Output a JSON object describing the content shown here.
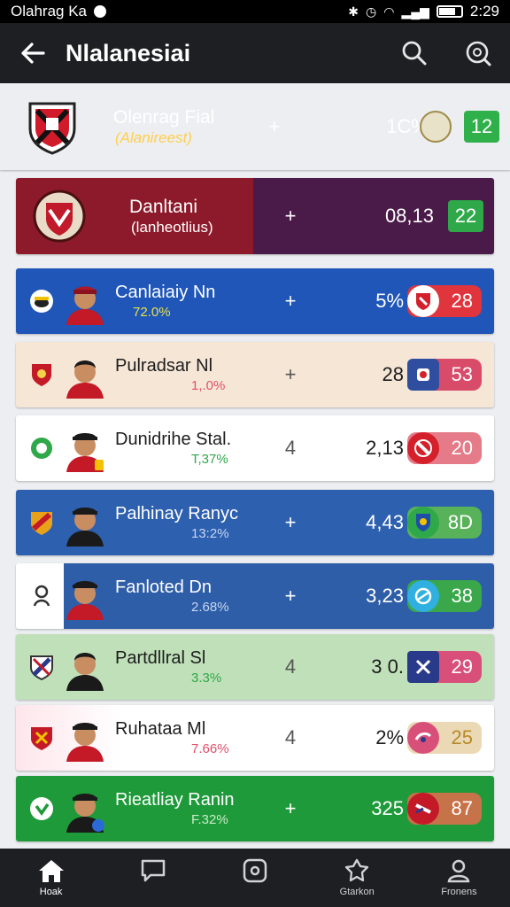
{
  "status_bar": {
    "left_text": "Olahrag Ka",
    "time": "2:29"
  },
  "app_bar": {
    "title": "Nlalanesiai",
    "icons": [
      "back-arrow-icon",
      "search-icon",
      "search-badge-icon"
    ]
  },
  "rows": [
    {
      "name": "Olenrag Fial",
      "sub": "(Alanireest)",
      "plus": "+",
      "stat": "1C%",
      "badge": "12",
      "bg": "#c4182c",
      "badge_bg": "#2fb04a"
    },
    {
      "name": "Danltani",
      "sub": "(lanheotlius)",
      "plus": "+",
      "stat": "08,13",
      "badge": "22",
      "bg": "#8d1a2a",
      "bg2": "#4a1a48",
      "badge_bg": "#2fa84a"
    },
    {
      "name": "Canlaiaiy Nn",
      "sub": "72.0%",
      "plus": "+",
      "stat": "5%",
      "badge": "28",
      "bg": "#1f56b8",
      "badge_bg": "#e0353d"
    },
    {
      "name": "Pulradsar Nl",
      "sub": "1,.0%",
      "plus": "+",
      "stat": "28",
      "badge": "53",
      "bg": "#f6e6d6",
      "badge_bg": "#d84c6a"
    },
    {
      "name": "Dunidrihe Stal.",
      "sub": "T,37%",
      "plus": "4",
      "stat": "2,13",
      "badge": "20",
      "bg": "#ffffff",
      "badge_bg": "#e57a88"
    },
    {
      "name": "Palhinay Ranyc",
      "sub": "13:2%",
      "plus": "+",
      "stat": "4,43",
      "badge": "8D",
      "bg": "#2e60b0",
      "badge_bg": "#58b25a"
    },
    {
      "name": "Fanloted Dn",
      "sub": "2.68%",
      "plus": "+",
      "stat": "3,23",
      "badge": "38",
      "bg": "#2e5ea8",
      "badge_bg": "#3aa84a"
    },
    {
      "name": "Partdllral Sl",
      "sub": "3.3%",
      "plus": "4",
      "stat": "3 0.",
      "badge": "29",
      "bg": "#bfe0b8",
      "badge_bg": "#d8507a"
    },
    {
      "name": "Ruhataa Ml",
      "sub": "7.66%",
      "plus": "4",
      "stat": "2%",
      "badge": "25",
      "bg": "#ffffff",
      "badge_bg": "#ead9b4"
    },
    {
      "name": "Rieatliay Ranin",
      "sub": "F.32%",
      "plus": "+",
      "stat": "325",
      "badge": "87",
      "bg": "#1f9a3a",
      "badge_bg": "#c7734a"
    }
  ],
  "nav": [
    {
      "label": "Hoak",
      "icon": "home-icon"
    },
    {
      "label": "",
      "icon": "chat-icon"
    },
    {
      "label": "",
      "icon": "media-icon"
    },
    {
      "label": "Gtarkon",
      "icon": "badge-icon"
    },
    {
      "label": "Fronens",
      "icon": "profile-icon"
    }
  ]
}
